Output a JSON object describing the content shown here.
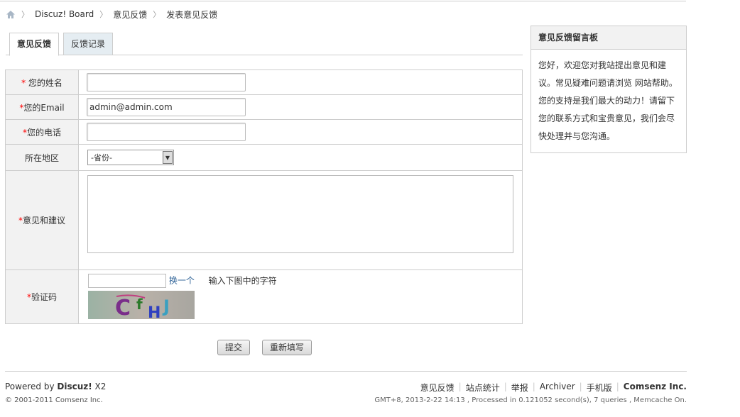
{
  "breadcrumb": {
    "items": [
      "Discuz! Board",
      "意见反馈",
      "发表意见反馈"
    ],
    "separator": "〉"
  },
  "tabs": [
    {
      "label": "意见反馈",
      "active": true
    },
    {
      "label": "反馈记录",
      "active": false
    }
  ],
  "form": {
    "name_label": "您的姓名",
    "email_label": "您的Email",
    "email_value": "admin@admin.com",
    "phone_label": "您的电话",
    "region_label": "所在地区",
    "region_selected": "-省份-",
    "advice_label": "意见和建议",
    "captcha_label": "验证码",
    "captcha_refresh": "换一个",
    "captcha_hint": "输入下图中的字符",
    "captcha_text": "CfHJ",
    "required_mark": "*"
  },
  "buttons": {
    "submit": "提交",
    "reset": "重新填写"
  },
  "sidebar": {
    "title": "意见反馈留言板",
    "body": "您好，欢迎您对我站提出意见和建议。常见疑难问题请浏览 网站帮助。您的支持是我们最大的动力！请留下您的联系方式和宝贵意见，我们会尽快处理并与您沟通。"
  },
  "footer": {
    "powered_prefix": "Powered by ",
    "powered_brand": "Discuz!",
    "powered_version": " X2",
    "copyright_prefix": "© 2001-2011 ",
    "copyright_company": "Comsenz Inc.",
    "links": [
      "意见反馈",
      "站点统计",
      "举报",
      "Archiver",
      "手机版",
      "Comsenz Inc."
    ],
    "debug": "GMT+8, 2013-2-22 14:13 , Processed in 0.121052 second(s), 7 queries , Memcache On."
  },
  "colors": {
    "link": "#336699",
    "required": "#ff0000",
    "label_bg": "#f2f2f2",
    "border": "#cdcdcd"
  }
}
